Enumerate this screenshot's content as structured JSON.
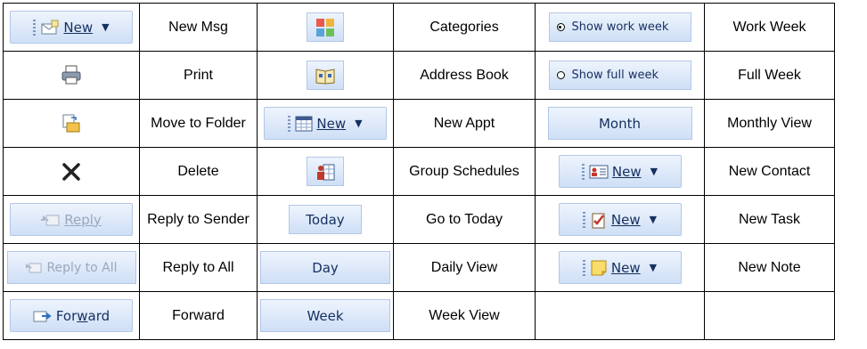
{
  "rows": [
    {
      "b1": {
        "label": "New",
        "icon": "new-mail-icon"
      },
      "l1": "New Msg",
      "b2": {
        "icon": "categories-icon"
      },
      "l2": "Categories",
      "b3": {
        "label": "Show work week",
        "selected": true
      },
      "l3": "Work Week"
    },
    {
      "b1": {
        "icon": "printer-icon"
      },
      "l1": "Print",
      "b2": {
        "icon": "address-book-icon"
      },
      "l2": "Address Book",
      "b3": {
        "label": "Show full week",
        "selected": false
      },
      "l3": "Full Week"
    },
    {
      "b1": {
        "icon": "move-to-folder-icon"
      },
      "l1": "Move to Folder",
      "b2": {
        "label": "New",
        "icon": "calendar-icon"
      },
      "l2": "New Appt",
      "b3": {
        "label": "Month"
      },
      "l3": "Monthly View"
    },
    {
      "b1": {
        "icon": "delete-icon"
      },
      "l1": "Delete",
      "b2": {
        "icon": "group-schedules-icon"
      },
      "l2": "Group Schedules",
      "b3": {
        "label": "New",
        "icon": "contact-card-icon"
      },
      "l3": "New Contact"
    },
    {
      "b1": {
        "label": "Reply",
        "icon": "reply-icon"
      },
      "l1": "Reply to Sender",
      "b2": {
        "label": "Today"
      },
      "l2": "Go to Today",
      "b3": {
        "label": "New",
        "icon": "task-icon"
      },
      "l3": "New Task"
    },
    {
      "b1": {
        "label": "Reply to All",
        "icon": "reply-all-icon"
      },
      "l1": "Reply to All",
      "b2": {
        "label": "Day"
      },
      "l2": "Daily View",
      "b3": {
        "label": "New",
        "icon": "note-icon"
      },
      "l3": "New Note"
    },
    {
      "b1": {
        "label": "Forward",
        "icon": "forward-icon"
      },
      "l1": "Forward",
      "b2": {
        "label": "Week"
      },
      "l2": "Week View",
      "b3": null,
      "l3": ""
    }
  ]
}
